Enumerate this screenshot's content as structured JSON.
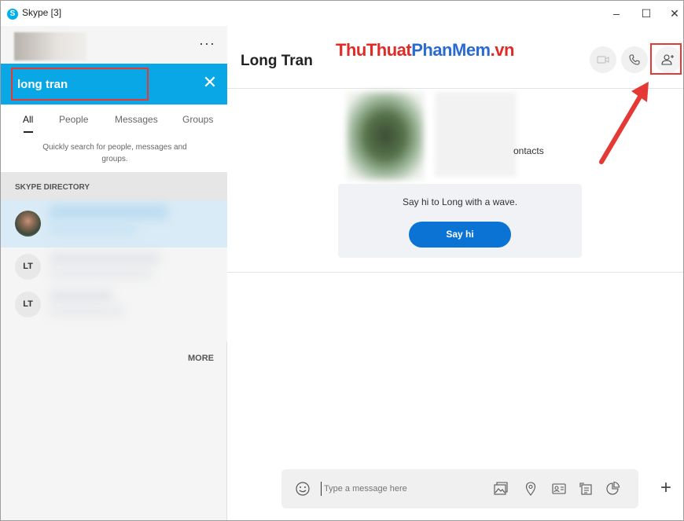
{
  "window": {
    "title": "Skype [3]",
    "logo_letter": "S",
    "minimize": "–",
    "maximize": "☐",
    "close": "✕"
  },
  "sidebar": {
    "more": "···",
    "search": {
      "value": "long tran",
      "clear": "✕"
    },
    "tabs": [
      {
        "label": "All",
        "active": true
      },
      {
        "label": "People",
        "active": false
      },
      {
        "label": "Messages",
        "active": false
      },
      {
        "label": "Groups",
        "active": false
      }
    ],
    "hint": "Quickly search for people, messages and groups.",
    "section_title": "SKYPE DIRECTORY",
    "results": [
      {
        "initials": "",
        "photo": true
      },
      {
        "initials": "LT",
        "photo": false
      },
      {
        "initials": "LT",
        "photo": false
      }
    ],
    "more_link": "MORE"
  },
  "main": {
    "title": "Long Tran",
    "watermark": {
      "part1": "ThuThuat",
      "part2": "PhanMem",
      "part3": ".vn"
    },
    "contacts_fragment": "ontacts",
    "wave_text": "Say hi to Long with a wave.",
    "say_hi": "Say hi",
    "compose": {
      "placeholder": "Type a message here",
      "plus": "+"
    }
  },
  "colors": {
    "skype_blue": "#0aa7e6",
    "button_blue": "#0a73d4",
    "highlight_red": "#e53935"
  }
}
